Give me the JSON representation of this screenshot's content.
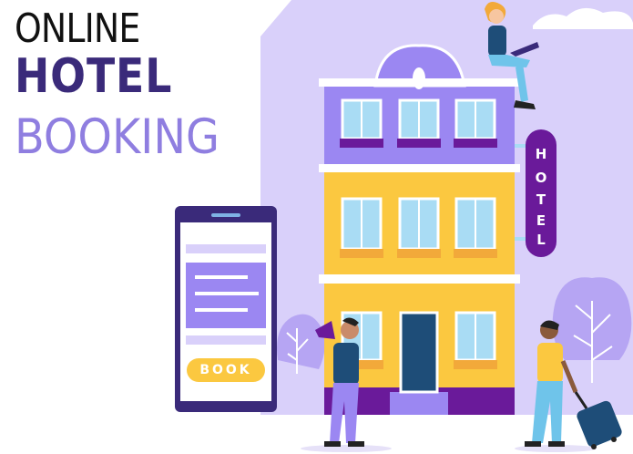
{
  "headline": {
    "line1": "ONLINE",
    "line2": "HOTEL",
    "line3": "BOOKING"
  },
  "phone": {
    "button_label": "BOOK"
  },
  "sign": {
    "letters": [
      "H",
      "O",
      "T",
      "E",
      "L"
    ]
  },
  "colors": {
    "lavender": "#d9d0fa",
    "purple": "#9b87f2",
    "dark_purple": "#3a2a7a",
    "deep_purple": "#6a1a9a",
    "yellow": "#fbc840",
    "window_blue": "#a9dcf4",
    "door_blue": "#1e4d78",
    "headline_dark": "#3a2a7a",
    "headline_light": "#8f7ee0"
  }
}
